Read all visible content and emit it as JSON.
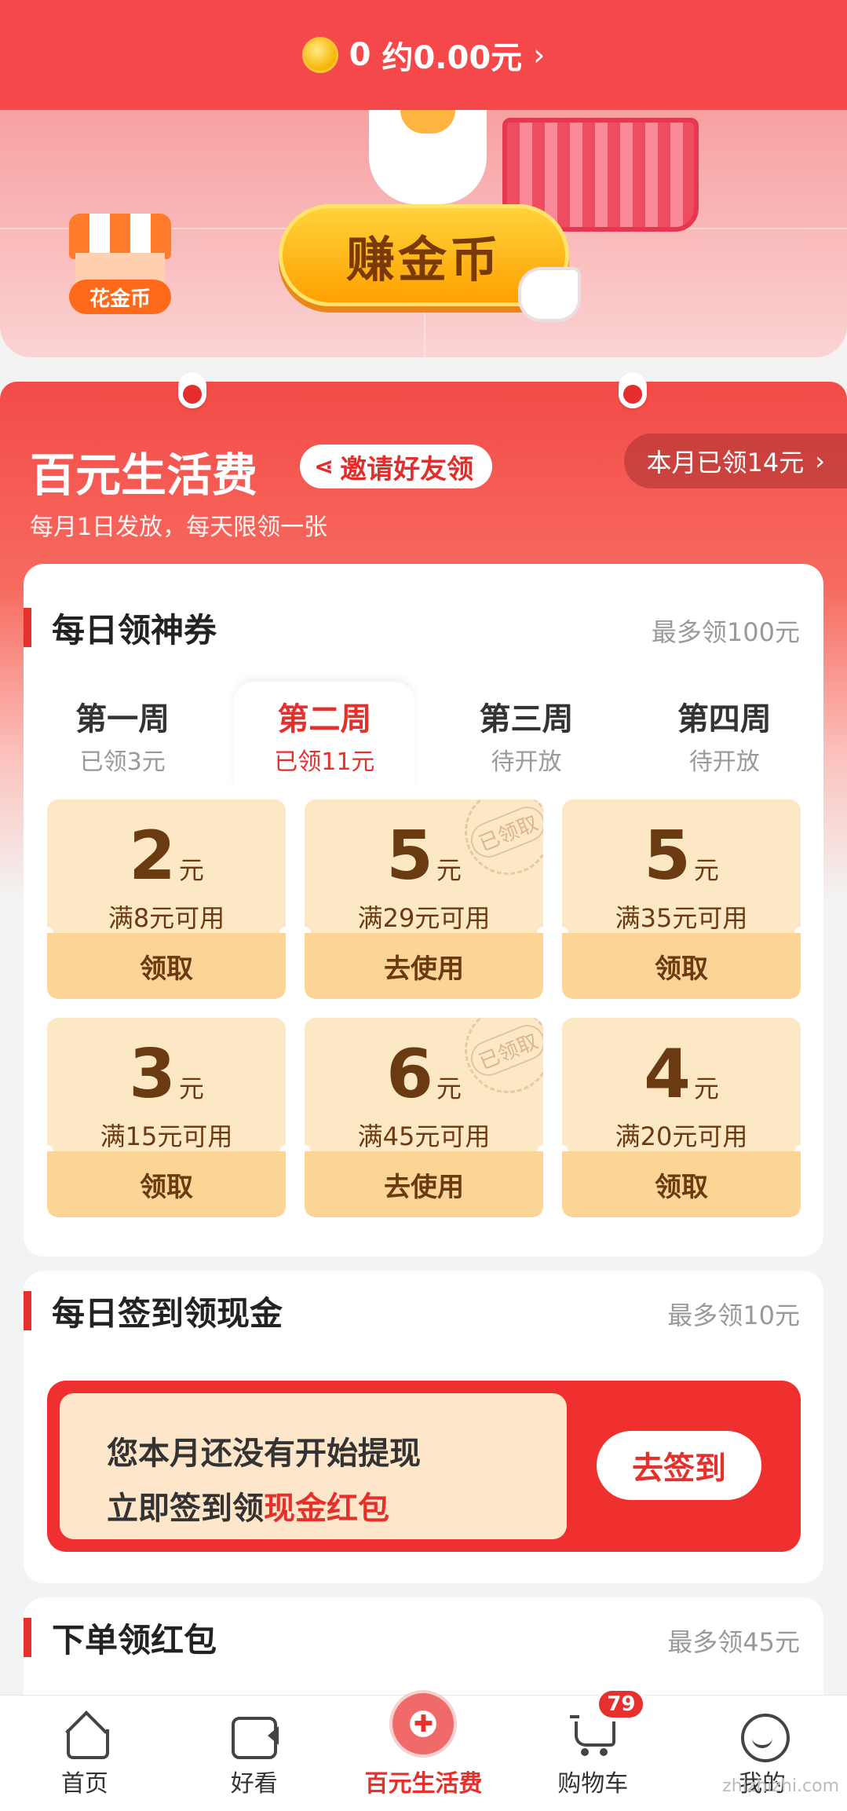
{
  "topbar": {
    "coins": "0",
    "amount": "约0.00元",
    "chevron": "›"
  },
  "banner": {
    "earn_label": "赚金币",
    "shop_label": "花金币"
  },
  "section": {
    "title": "百元生活费",
    "invite_label": "邀请好友领",
    "month_label": "本月已领14元",
    "month_chevron": "›",
    "subtitle": "每月1日发放，每天限领一张"
  },
  "coupons": {
    "title": "每日领神券",
    "max": "最多领100元",
    "weeks": [
      {
        "name": "第一周",
        "status": "已领3元"
      },
      {
        "name": "第二周",
        "status": "已领11元"
      },
      {
        "name": "第三周",
        "status": "待开放"
      },
      {
        "name": "第四周",
        "status": "待开放"
      }
    ],
    "unit": "元",
    "stamp": "已领取",
    "items": [
      {
        "value": "2",
        "cond": "满8元可用",
        "action": "领取"
      },
      {
        "value": "5",
        "cond": "满29元可用",
        "action": "去使用"
      },
      {
        "value": "5",
        "cond": "满35元可用",
        "action": "领取"
      },
      {
        "value": "3",
        "cond": "满15元可用",
        "action": "领取"
      },
      {
        "value": "6",
        "cond": "满45元可用",
        "action": "去使用"
      },
      {
        "value": "4",
        "cond": "满20元可用",
        "action": "领取"
      }
    ]
  },
  "signin": {
    "title": "每日签到领现金",
    "max": "最多领10元",
    "line1": "您本月还没有开始提现",
    "line2_prefix": "立即签到领",
    "line2_highlight": "现金红包",
    "button": "去签到"
  },
  "order": {
    "title": "下单领红包",
    "max": "最多领45元"
  },
  "nav": {
    "items": [
      {
        "label": "首页",
        "icon": "home-icon"
      },
      {
        "label": "好看",
        "icon": "video-icon"
      },
      {
        "label": "百元生活费",
        "icon": "red-envelope-icon"
      },
      {
        "label": "购物车",
        "icon": "cart-icon",
        "badge": "79"
      },
      {
        "label": "我的",
        "icon": "profile-icon"
      }
    ]
  },
  "watermark": "zhizhizhi.com"
}
